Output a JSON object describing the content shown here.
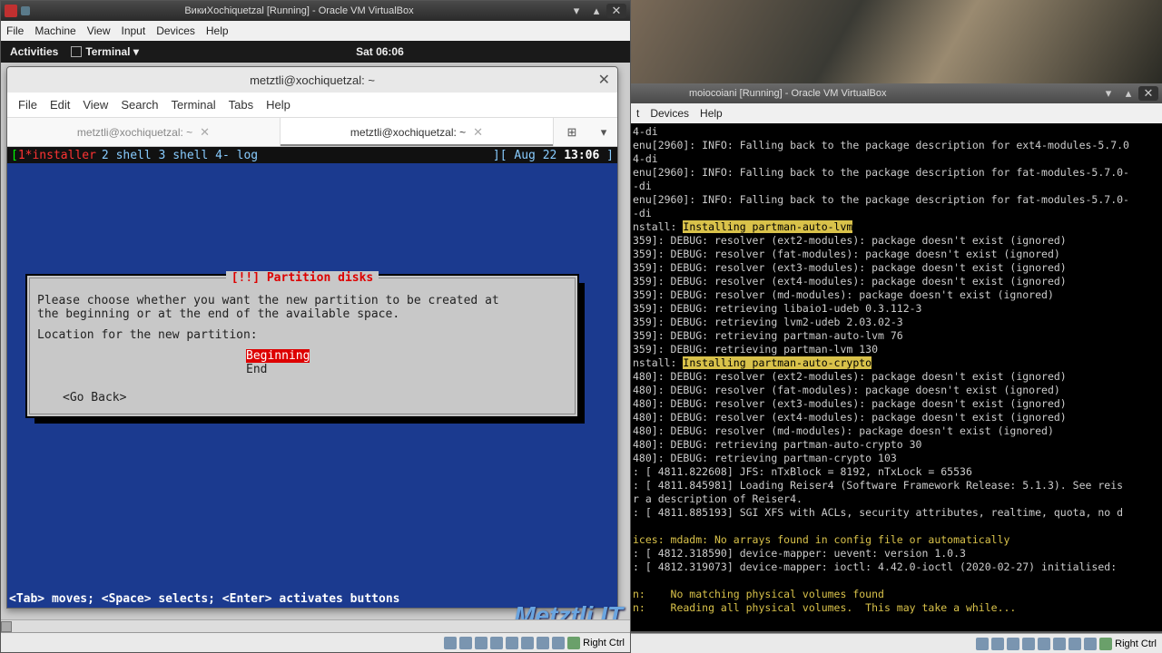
{
  "vm_left": {
    "title": "ВикиXochiquetzal [Running] - Oracle VM VirtualBox",
    "menu": [
      "File",
      "Machine",
      "View",
      "Input",
      "Devices",
      "Help"
    ],
    "gnome": {
      "activities": "Activities",
      "terminal": "Terminal ▾",
      "clock": "Sat 06:06"
    }
  },
  "term": {
    "title": "metztli@xochiquetzal: ~",
    "menu": [
      "File",
      "Edit",
      "View",
      "Search",
      "Terminal",
      "Tabs",
      "Help"
    ],
    "tabs": [
      {
        "label": "metztli@xochiquetzal: ~",
        "active": false
      },
      {
        "label": "metztli@xochiquetzal: ~",
        "active": true
      }
    ],
    "status_inst": "1*installer",
    "status_rest": "  2 shell  3 shell  4- log",
    "status_time": "Aug 22 ",
    "status_time_b": "13:06"
  },
  "dialog": {
    "title": "[!!] Partition disks",
    "body": "Please choose whether you want the new partition to be created at\nthe beginning or at the end of the available space.",
    "prompt": "Location for the new partition:",
    "opt1": "Beginning",
    "opt2": "End",
    "goback": "<Go Back>"
  },
  "hint": "<Tab> moves; <Space> selects; <Enter> activates buttons",
  "watermark": "Metztli IT",
  "vm_right": {
    "title": "moiocoiani [Running] - Oracle VM VirtualBox",
    "menu": [
      "t",
      "Devices",
      "Help"
    ]
  },
  "statusbar": {
    "hostkey": "Right Ctrl"
  },
  "log": [
    "4-di",
    "enu[2960]: INFO: Falling back to the package description for ext4-modules-5.7.0",
    "4-di",
    "enu[2960]: INFO: Falling back to the package description for fat-modules-5.7.0-",
    "-di",
    "enu[2960]: INFO: Falling back to the package description for fat-modules-5.7.0-",
    "-di",
    "nstall: Installing partman-auto-lvm",
    "359]: DEBUG: resolver (ext2-modules): package doesn't exist (ignored)",
    "359]: DEBUG: resolver (fat-modules): package doesn't exist (ignored)",
    "359]: DEBUG: resolver (ext3-modules): package doesn't exist (ignored)",
    "359]: DEBUG: resolver (ext4-modules): package doesn't exist (ignored)",
    "359]: DEBUG: resolver (md-modules): package doesn't exist (ignored)",
    "359]: DEBUG: retrieving libaio1-udeb 0.3.112-3",
    "359]: DEBUG: retrieving lvm2-udeb 2.03.02-3",
    "359]: DEBUG: retrieving partman-auto-lvm 76",
    "359]: DEBUG: retrieving partman-lvm 130",
    "nstall: Installing partman-auto-crypto",
    "480]: DEBUG: resolver (ext2-modules): package doesn't exist (ignored)",
    "480]: DEBUG: resolver (fat-modules): package doesn't exist (ignored)",
    "480]: DEBUG: resolver (ext3-modules): package doesn't exist (ignored)",
    "480]: DEBUG: resolver (ext4-modules): package doesn't exist (ignored)",
    "480]: DEBUG: resolver (md-modules): package doesn't exist (ignored)",
    "480]: DEBUG: retrieving partman-auto-crypto 30",
    "480]: DEBUG: retrieving partman-crypto 103",
    ": [ 4811.822608] JFS: nTxBlock = 8192, nTxLock = 65536",
    ": [ 4811.845981] Loading Reiser4 (Software Framework Release: 5.1.3). See reis",
    "r a description of Reiser4.",
    ": [ 4811.885193] SGI XFS with ACLs, security attributes, realtime, quota, no d",
    "",
    "ices: mdadm: No arrays found in config file or automatically",
    ": [ 4812.318590] device-mapper: uevent: version 1.0.3",
    ": [ 4812.319073] device-mapper: ioctl: 4.42.0-ioctl (2020-02-27) initialised:",
    "",
    "n:    No matching physical volumes found",
    "n:    Reading all physical volumes.  This may take a while..."
  ]
}
